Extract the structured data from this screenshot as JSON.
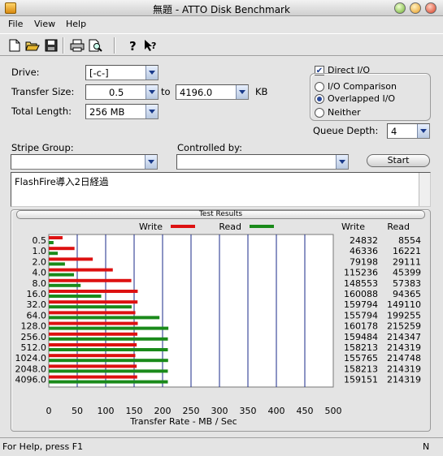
{
  "window": {
    "title": "無題 - ATTO Disk Benchmark"
  },
  "menu": [
    "File",
    "View",
    "Help"
  ],
  "toolbar": [
    "new-icon",
    "open-icon",
    "save-icon",
    "print-icon",
    "print-preview-icon",
    "help-icon",
    "context-help-icon"
  ],
  "form": {
    "drive_label": "Drive:",
    "drive_value": "[-c-]",
    "transfer_size_label": "Transfer Size:",
    "transfer_from": "0.5",
    "to_label": "to",
    "transfer_to": "4196.0",
    "kb_label": "KB",
    "total_length_label": "Total Length:",
    "total_length_value": "256 MB",
    "direct_io_label": "Direct I/O",
    "direct_io_checked": true,
    "io_comparison_label": "I/O Comparison",
    "overlapped_io_label": "Overlapped I/O",
    "neither_label": "Neither",
    "selected_mode": "Overlapped I/O",
    "queue_depth_label": "Queue Depth:",
    "queue_depth_value": "4",
    "stripe_group_label": "Stripe Group:",
    "stripe_group_value": "",
    "controlled_by_label": "Controlled by:",
    "controlled_by_value": "",
    "start_label": "Start",
    "description": "FlashFire導入2日経過"
  },
  "results": {
    "header": "Test Results",
    "legend_write": "Write",
    "legend_read": "Read",
    "col_write": "Write",
    "col_read": "Read",
    "write_color": "#dd1111",
    "read_color": "#1a8a1a"
  },
  "chart_data": {
    "type": "bar",
    "orientation": "horizontal",
    "categories": [
      "0.5",
      "1.0",
      "2.0",
      "4.0",
      "8.0",
      "16.0",
      "32.0",
      "64.0",
      "128.0",
      "256.0",
      "512.0",
      "1024.0",
      "2048.0",
      "4096.0"
    ],
    "series": [
      {
        "name": "Write",
        "values": [
          24832,
          46336,
          79198,
          115236,
          148553,
          160088,
          159794,
          155794,
          160178,
          159484,
          158213,
          155765,
          158213,
          159151
        ]
      },
      {
        "name": "Read",
        "values": [
          8554,
          16221,
          29111,
          45399,
          57383,
          94365,
          149110,
          199255,
          215259,
          214347,
          214319,
          214748,
          214319,
          214319
        ]
      }
    ],
    "xlabel": "Transfer Rate - MB / Sec",
    "xlim": [
      0,
      500
    ],
    "xticks": [
      "0",
      "50",
      "100",
      "150",
      "200",
      "250",
      "300",
      "350",
      "400",
      "450",
      "500"
    ],
    "grid": true
  },
  "status": {
    "message": "For Help, press F1",
    "indicator": "N"
  }
}
